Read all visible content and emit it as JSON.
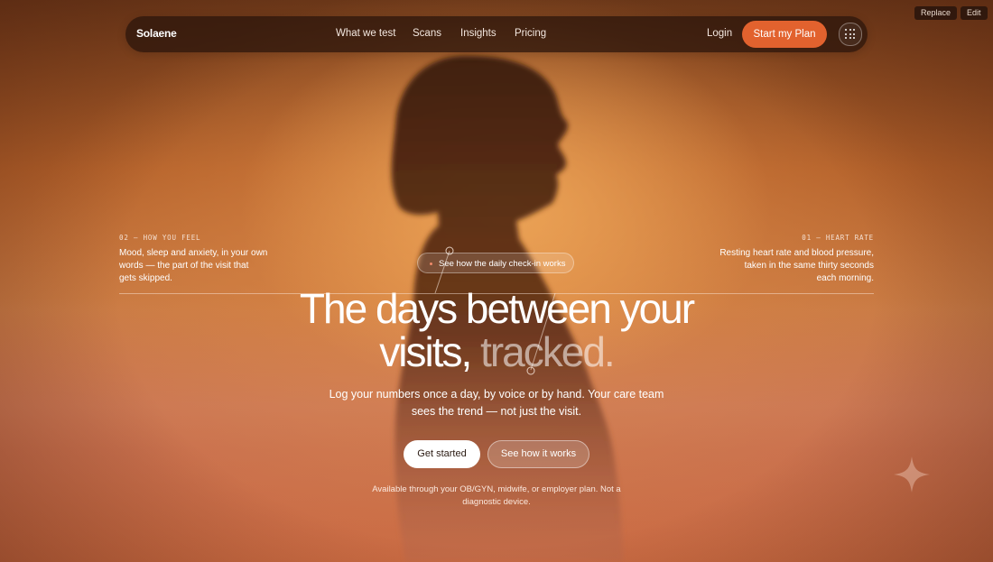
{
  "editor": {
    "replace_label": "Replace",
    "edit_label": "Edit"
  },
  "nav": {
    "brand": "Solaene",
    "links": [
      "What we test",
      "Scans",
      "Insights",
      "Pricing"
    ],
    "login": "Login",
    "cta": "Start my Plan",
    "menu_icon": "grid-icon"
  },
  "left_note": {
    "tag": "02 — HOW YOU FEEL",
    "lines": [
      "Mood, sleep and anxiety, in your own",
      "words — the part of the visit that",
      "gets skipped."
    ]
  },
  "right_note": {
    "tag": "01 — HEART RATE",
    "lines": [
      "Resting heart rate and blood pressure,",
      "taken in the same thirty seconds",
      "each morning."
    ]
  },
  "hero": {
    "pill": "See how the daily check-in works",
    "headline_line1": "The days between your",
    "headline_line2_a": "visits,",
    "headline_line2_b": "tracked.",
    "subtitle_line1": "Log your numbers once a day, by voice or by hand. Your care team",
    "subtitle_line2": "sees the trend — not just the visit.",
    "primary_button": "Get started",
    "secondary_button": "See how it works",
    "fine_line1": "Available through your OB/GYN, midwife, or employer plan. Not a",
    "fine_line2": "diagnostic device."
  },
  "colors": {
    "accent": "#e2622e",
    "nav_bg": "#2d160c"
  }
}
